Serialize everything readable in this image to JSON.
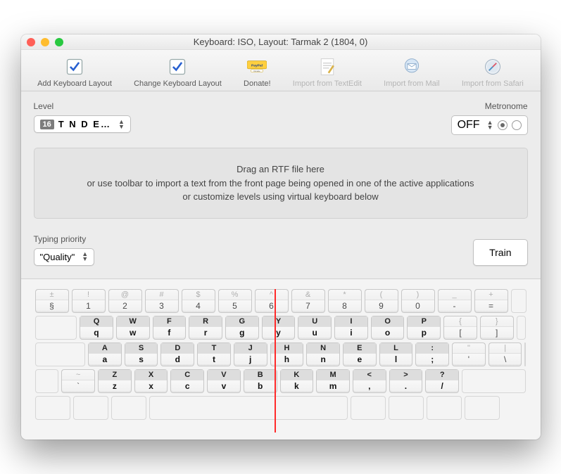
{
  "window": {
    "title": "Keyboard: ISO, Layout: Tarmak 2 (1804, 0)"
  },
  "toolbar": {
    "add": "Add Keyboard Layout",
    "change": "Change Keyboard Layout",
    "donate": "Donate!",
    "import_textedit": "Import from TextEdit",
    "import_mail": "Import from Mail",
    "import_safari": "Import from Safari"
  },
  "level": {
    "label": "Level",
    "number": "16",
    "text": "T N D E…"
  },
  "metronome": {
    "label": "Metronome",
    "value": "OFF"
  },
  "drop": {
    "line1": "Drag an RTF file here",
    "line2": "or use toolbar to import a text from the front page being opened in one of the active applications",
    "line3": "or customize levels using virtual keyboard below"
  },
  "priority": {
    "label": "Typing priority",
    "value": "\"Quality\""
  },
  "train": {
    "label": "Train"
  },
  "keyboard": {
    "r1": [
      {
        "u": "±",
        "l": "§"
      },
      {
        "u": "!",
        "l": "1"
      },
      {
        "u": "@",
        "l": "2"
      },
      {
        "u": "#",
        "l": "3"
      },
      {
        "u": "$",
        "l": "4"
      },
      {
        "u": "%",
        "l": "5"
      },
      {
        "u": "^",
        "l": "6"
      },
      {
        "u": "&",
        "l": "7"
      },
      {
        "u": "*",
        "l": "8"
      },
      {
        "u": "(",
        "l": "9"
      },
      {
        "u": ")",
        "l": "0"
      },
      {
        "u": "_",
        "l": "-"
      },
      {
        "u": "+",
        "l": "="
      }
    ],
    "r2": [
      {
        "u": "Q",
        "l": "q",
        "a": true
      },
      {
        "u": "W",
        "l": "w",
        "a": true
      },
      {
        "u": "F",
        "l": "f",
        "a": true
      },
      {
        "u": "R",
        "l": "r",
        "a": true
      },
      {
        "u": "G",
        "l": "g",
        "a": true
      },
      {
        "u": "Y",
        "l": "y",
        "a": true
      },
      {
        "u": "U",
        "l": "u",
        "a": true
      },
      {
        "u": "I",
        "l": "i",
        "a": true
      },
      {
        "u": "O",
        "l": "o",
        "a": true
      },
      {
        "u": "P",
        "l": "p",
        "a": true
      },
      {
        "u": "{",
        "l": "["
      },
      {
        "u": "}",
        "l": "]"
      }
    ],
    "r3": [
      {
        "u": "A",
        "l": "a",
        "a": true
      },
      {
        "u": "S",
        "l": "s",
        "a": true
      },
      {
        "u": "D",
        "l": "d",
        "a": true
      },
      {
        "u": "T",
        "l": "t",
        "a": true
      },
      {
        "u": "J",
        "l": "j",
        "a": true
      },
      {
        "u": "H",
        "l": "h",
        "a": true
      },
      {
        "u": "N",
        "l": "n",
        "a": true
      },
      {
        "u": "E",
        "l": "e",
        "a": true
      },
      {
        "u": "L",
        "l": "l",
        "a": true
      },
      {
        "u": ":",
        "l": ";",
        "a": true
      },
      {
        "u": "\"",
        "l": "'"
      },
      {
        "u": "|",
        "l": "\\"
      }
    ],
    "r4": [
      {
        "u": "~",
        "l": "`"
      },
      {
        "u": "Z",
        "l": "z",
        "a": true
      },
      {
        "u": "X",
        "l": "x",
        "a": true
      },
      {
        "u": "C",
        "l": "c",
        "a": true
      },
      {
        "u": "V",
        "l": "v",
        "a": true
      },
      {
        "u": "B",
        "l": "b",
        "a": true
      },
      {
        "u": "K",
        "l": "k",
        "a": true
      },
      {
        "u": "M",
        "l": "m",
        "a": true
      },
      {
        "u": "<",
        "l": ",",
        "a": true
      },
      {
        "u": ">",
        "l": ".",
        "a": true
      },
      {
        "u": "?",
        "l": "/",
        "a": true
      }
    ]
  }
}
